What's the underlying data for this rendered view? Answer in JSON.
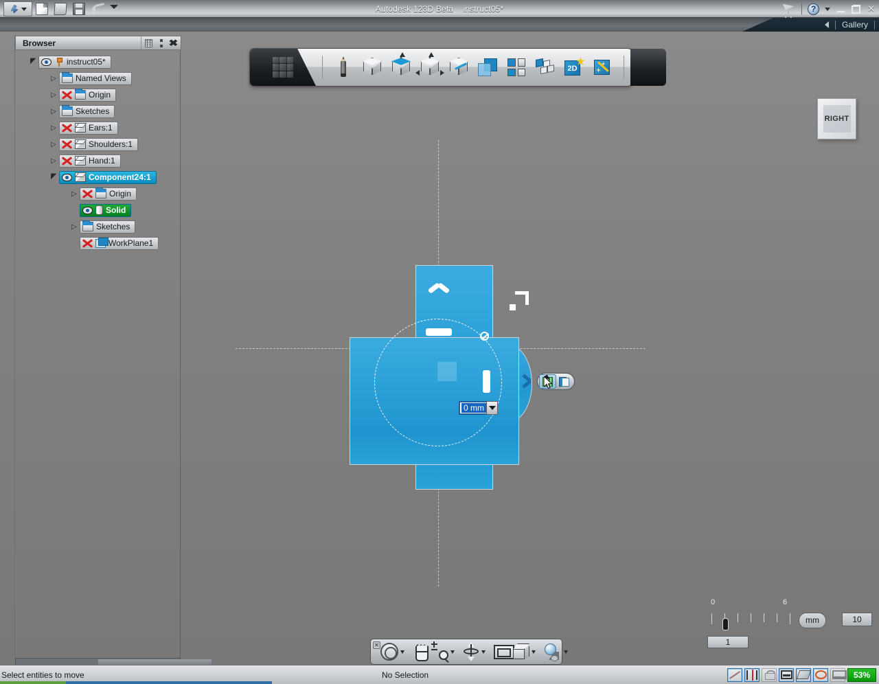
{
  "titlebar": {
    "app_title": "Autodesk 123D Beta",
    "document_name": "instruct05*",
    "app_menu_icon": "autodesk-logo-icon",
    "quick_access": [
      {
        "name": "new-file-icon",
        "label": "New"
      },
      {
        "name": "open-file-icon",
        "label": "Open"
      },
      {
        "name": "save-file-icon",
        "label": "Save"
      },
      {
        "name": "undo-icon",
        "label": "Undo"
      },
      {
        "name": "customize-qat-icon",
        "label": "Customize Quick Access Toolbar"
      }
    ],
    "right_icons": [
      {
        "name": "satellite-dish-icon",
        "label": "Connect"
      },
      {
        "name": "help-icon",
        "label": "?"
      },
      {
        "name": "help-dropdown-icon",
        "label": "Help options"
      }
    ],
    "window_controls": [
      {
        "name": "minimize-button",
        "label": "Minimize"
      },
      {
        "name": "restore-button",
        "label": "Restore"
      },
      {
        "name": "close-button",
        "label": "X"
      }
    ]
  },
  "gallery_bar": {
    "arrow_icon": "collapse-left-icon",
    "label": "Gallery"
  },
  "browser": {
    "title": "Browser",
    "header_buttons": [
      {
        "name": "browser-grid-button",
        "label": "Filter"
      },
      {
        "name": "browser-dots-button",
        "label": "Options"
      },
      {
        "name": "browser-close-button",
        "label": "X"
      }
    ],
    "tree": [
      {
        "label": "instruct05*",
        "indent": 0,
        "expander": "open",
        "icons": [
          "eye-icon",
          "pin-icon"
        ],
        "state": "normal"
      },
      {
        "label": "Named Views",
        "indent": 1,
        "expander": "closed",
        "icons": [
          "folder-icon"
        ],
        "state": "normal"
      },
      {
        "label": "Origin",
        "indent": 1,
        "expander": "closed",
        "icons": [
          "red-x-icon",
          "folder-icon"
        ],
        "state": "normal"
      },
      {
        "label": "Sketches",
        "indent": 1,
        "expander": "closed",
        "icons": [
          "folder-icon"
        ],
        "state": "normal"
      },
      {
        "label": "Ears:1",
        "indent": 1,
        "expander": "closed",
        "icons": [
          "red-x-icon",
          "cube-icon"
        ],
        "state": "normal"
      },
      {
        "label": "Shoulders:1",
        "indent": 1,
        "expander": "closed",
        "icons": [
          "red-x-icon",
          "cube-icon"
        ],
        "state": "normal"
      },
      {
        "label": "Hand:1",
        "indent": 1,
        "expander": "closed",
        "icons": [
          "red-x-icon",
          "cube-icon"
        ],
        "state": "normal"
      },
      {
        "label": "Component24:1",
        "indent": 1,
        "expander": "open",
        "icons": [
          "eye-icon",
          "cube-icon"
        ],
        "state": "selected"
      },
      {
        "label": "Origin",
        "indent": 2,
        "expander": "closed",
        "icons": [
          "red-x-icon",
          "folder-icon"
        ],
        "state": "normal"
      },
      {
        "label": "Solid",
        "indent": 2,
        "expander": "none",
        "icons": [
          "eye-icon",
          "cylinder-icon"
        ],
        "state": "green"
      },
      {
        "label": "Sketches",
        "indent": 2,
        "expander": "closed",
        "icons": [
          "folder-icon"
        ],
        "state": "normal"
      },
      {
        "label": "WorkPlane1",
        "indent": 2,
        "expander": "none",
        "icons": [
          "red-x-icon",
          "workplane-icon"
        ],
        "state": "normal"
      }
    ],
    "scrollbar": "horizontal-scrollbar"
  },
  "ribbon": {
    "cap_icon": "cube-grid-icon",
    "tools": [
      {
        "name": "sketch-tool",
        "label": "Sketch",
        "icon": "pencil-icon"
      },
      {
        "name": "primitives-tool",
        "label": "Primitives",
        "icon": "cube-icon"
      },
      {
        "name": "extrude-tool",
        "label": "Extrude",
        "icon": "cube-blue-top-icon"
      },
      {
        "name": "transform-tool",
        "label": "Transform",
        "icon": "cube-arrows-icon"
      },
      {
        "name": "modify-tool",
        "label": "Modify",
        "icon": "cube-pencil-icon"
      },
      {
        "name": "combine-tool",
        "label": "Combine",
        "icon": "overlap-squares-icon"
      },
      {
        "name": "pattern-tool",
        "label": "Pattern",
        "icon": "four-squares-icon"
      },
      {
        "name": "group-tool",
        "label": "Group",
        "icon": "blocks-icon"
      },
      {
        "name": "sketch2d-tool",
        "label": "2D Sketch",
        "icon": "2d-star-icon"
      },
      {
        "name": "smart-tool",
        "label": "Smart",
        "icon": "magic-wand-icon"
      }
    ]
  },
  "viewcube": {
    "label": "RIGHT"
  },
  "model": {
    "dimension_input": {
      "value": "0 mm",
      "dropdown_icon": "chevron-down-icon"
    },
    "manipulator_buttons": [
      {
        "name": "snap-manipulator-button",
        "icon": "green-snap-icon",
        "active": true
      },
      {
        "name": "copy-manipulator-button",
        "icon": "copy-pages-icon",
        "active": false
      }
    ],
    "gizmos": [
      {
        "name": "move-up-handle",
        "icon": "chevron-up-icon"
      },
      {
        "name": "horizontal-drag-handle",
        "icon": "dash-handle-icon"
      },
      {
        "name": "vertical-drag-handle",
        "icon": "bar-handle-icon"
      },
      {
        "name": "rotate-handle",
        "icon": "circle-slash-icon"
      },
      {
        "name": "corner-resize-gizmo",
        "icon": "corner-arrow-icon"
      },
      {
        "name": "center-square-handle",
        "icon": "square-handle-icon"
      }
    ]
  },
  "scale_widget": {
    "tick_start_label": "0",
    "tick_end_label": "6",
    "current_value": "1",
    "unit": "mm",
    "max_value": "10"
  },
  "navbar": {
    "close_icon": "close-small-icon",
    "expand_icon": "expand-dot-icon",
    "items": [
      {
        "name": "orbit-tool",
        "label": "Orbit",
        "icon": "orbit-icon",
        "has_dropdown": true
      },
      {
        "name": "pan-tool",
        "label": "Pan",
        "icon": "hand-icon",
        "has_dropdown": false
      },
      {
        "name": "zoom-tool",
        "label": "Zoom",
        "icon": "zoom-magnifier-icon",
        "has_dropdown": true
      },
      {
        "name": "pivot-tool",
        "label": "Set Pivot",
        "icon": "pivot-axis-icon",
        "has_dropdown": true
      },
      {
        "name": "fit-view-tool",
        "label": "Fit View",
        "icon": "screen-fit-icon",
        "has_dropdown": false
      },
      {
        "name": "view-cube-tool",
        "label": "View Cube",
        "icon": "cube-view-icon",
        "has_dropdown": true
      },
      {
        "name": "look-at-tool",
        "label": "Look At",
        "icon": "sphere-look-icon",
        "has_dropdown": true
      }
    ]
  },
  "statusbar": {
    "prompt": "Select entities to move",
    "selection": "No Selection",
    "toggles": [
      {
        "name": "sketch-line-toggle",
        "icon": "line-icon",
        "state": "on"
      },
      {
        "name": "snap-toggle",
        "icon": "snap-icon",
        "state": "on"
      },
      {
        "name": "lock-toggle",
        "icon": "lock-icon",
        "state": "off"
      },
      {
        "name": "grid-toggle",
        "icon": "frame-icon",
        "state": "on"
      },
      {
        "name": "plane-toggle",
        "icon": "plate-icon",
        "state": "on"
      },
      {
        "name": "orbit-toggle",
        "icon": "orbit-red-icon",
        "state": "on"
      },
      {
        "name": "display-toggle",
        "icon": "monitor-icon",
        "state": "off"
      }
    ],
    "progress_label": "53%",
    "progress_color": "#0b9a0b"
  }
}
